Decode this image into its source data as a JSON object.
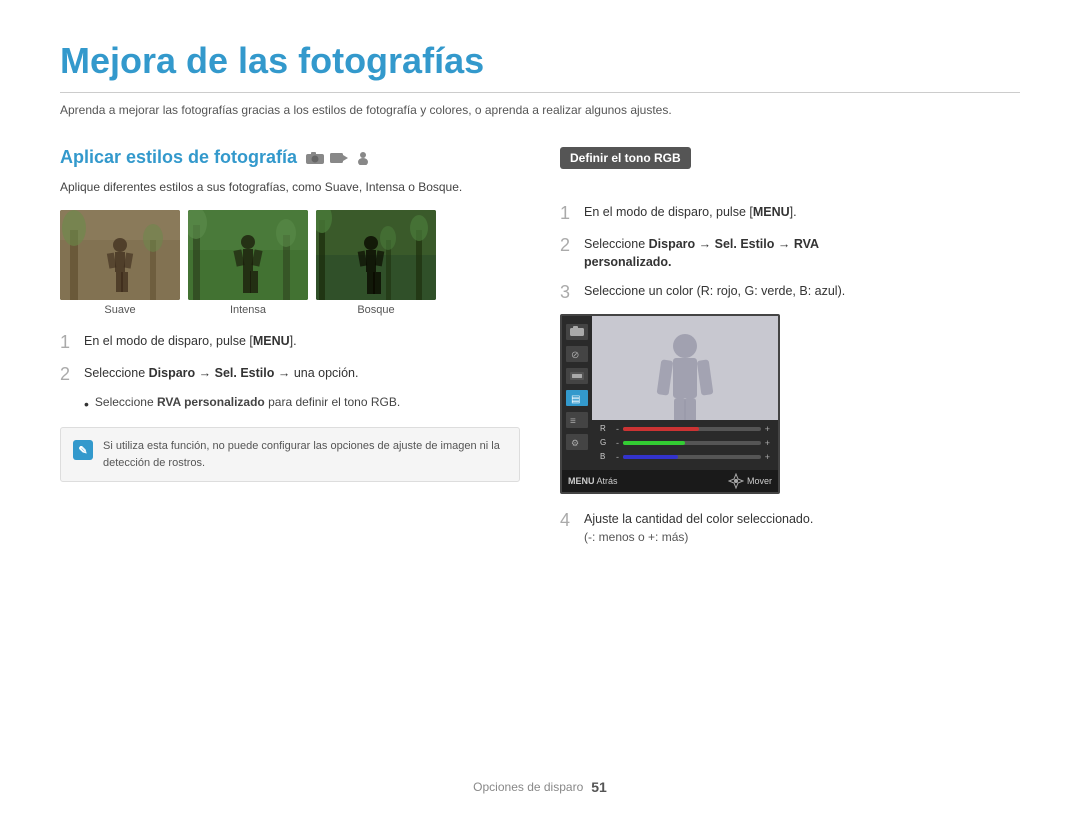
{
  "page": {
    "title": "Mejora de las fotografías",
    "subtitle": "Aprenda a mejorar las fotografías gracias a los estilos de fotografía y colores, o aprenda a realizar algunos ajustes.",
    "footer_text": "Opciones de disparo",
    "footer_page": "51"
  },
  "left": {
    "section_title": "Aplicar estilos de fotografía",
    "section_desc": "Aplique diferentes estilos a sus fotografías, como Suave, Intensa o Bosque.",
    "photos": [
      {
        "label": "Suave"
      },
      {
        "label": "Intensa"
      },
      {
        "label": "Bosque"
      }
    ],
    "steps": [
      {
        "num": "1",
        "text_before": "En el modo de disparo, pulse [",
        "bold": "MENU",
        "text_after": "]."
      },
      {
        "num": "2",
        "text_plain": "Seleccione ",
        "bold1": "Disparo",
        "arrow1": " → ",
        "bold2": "Sel. Estilo",
        "arrow2": " → una opción."
      }
    ],
    "bullet": "Seleccione RVA personalizado para definir el tono RGB.",
    "note_text": "Si utiliza esta función, no puede configurar las opciones de ajuste de imagen ni la detección de rostros."
  },
  "right": {
    "badge_text": "Definir el tono RGB",
    "steps": [
      {
        "num": "1",
        "text_before": "En el modo de disparo, pulse [",
        "bold": "MENU",
        "text_after": "]."
      },
      {
        "num": "2",
        "text_plain": "Seleccione ",
        "bold1": "Disparo",
        "arrow1": " → ",
        "bold2": "Sel. Estilo",
        "arrow2": " → ",
        "bold3": "RVA",
        "text_end": ""
      },
      {
        "num": "3",
        "text": "Seleccione un color (R: rojo, G: verde, B: azul)."
      },
      {
        "num": "4",
        "text": "Ajuste la cantidad del color seleccionado."
      }
    ],
    "step2_line2": "personalizado.",
    "step4_sub": "(-: menos o +: más)",
    "screen": {
      "sliders": [
        {
          "label": "R",
          "value": 55
        },
        {
          "label": "G",
          "value": 45
        },
        {
          "label": "B",
          "value": 40
        }
      ],
      "bottom_left": "MENU Atrás",
      "bottom_right": "Mover"
    }
  }
}
